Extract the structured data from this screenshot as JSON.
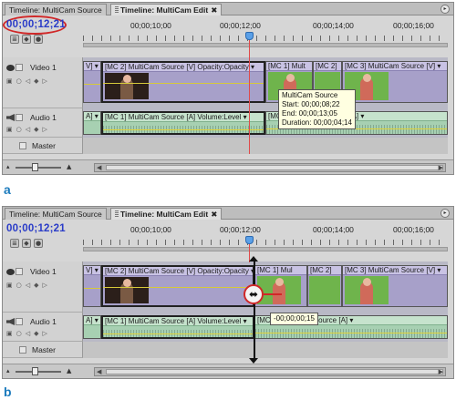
{
  "figures": [
    {
      "label": "a",
      "tabs": {
        "source": "Timeline: MultiCam Source",
        "edit": "Timeline: MultiCam Edit"
      },
      "timecode": "00;00;12;21",
      "ruler": [
        "00;00;10;00",
        "00;00;12;00",
        "00;00;14;00",
        "00;00;16;00"
      ],
      "tracks": {
        "video": "Video 1",
        "audio": "Audio 1",
        "master": "Master"
      },
      "clips": {
        "v_left": "V] ▾",
        "v_mc2": "[MC 2] MultiCam Source [V]  Opacity:Opacity ▾",
        "v_mc1": "[MC 1] Mult",
        "v_mc2b": "[MC 2]",
        "v_mc3": "[MC 3] MultiCam Source [V] ▾",
        "a_left": "A] ▾",
        "a_mc1": "[MC 1] MultiCam Source [A]  Volume:Level ▾",
        "a_right": "[MC 1] MultiCam Source [A] ▾"
      },
      "tooltip": [
        "MultiCam Source",
        "Start: 00;00;08;22",
        "End: 00;00;13;05",
        "Duration: 00;00;04;14"
      ]
    },
    {
      "label": "b",
      "tabs": {
        "source": "Timeline: MultiCam Source",
        "edit": "Timeline: MultiCam Edit"
      },
      "timecode": "00;00;12;21",
      "ruler": [
        "00;00;10;00",
        "00;00;12;00",
        "00;00;14;00",
        "00;00;16;00"
      ],
      "tracks": {
        "video": "Video 1",
        "audio": "Audio 1",
        "master": "Master"
      },
      "clips": {
        "v_left": "V] ▾",
        "v_mc2": "[MC 2] MultiCam Source [V]  Opacity:Opacity ▾",
        "v_mc1": "[MC 1] Mul",
        "v_mc2b": "[MC 2]",
        "v_mc3": "[MC 3] MultiCam Source [V] ▾",
        "a_left": "A] ▾",
        "a_mc1": "[MC 1] MultiCam Source [A]  Volume:Level ▾",
        "a_right": "[MC 1] MultiCam Source [A] ▾"
      },
      "tooltip": [
        "-00;00;00;15"
      ]
    }
  ],
  "icons": [
    "eye-icon",
    "speaker-icon",
    "close-icon",
    "panel-menu-icon",
    "trim-cursor-icon",
    "playhead-icon"
  ],
  "colors": {
    "timecode": "#2a3cc8",
    "highlight": "#d02828",
    "video_clip": "#a7a0c9",
    "audio_clip": "#a7d0b2",
    "fig_label": "#1c7bbd"
  }
}
